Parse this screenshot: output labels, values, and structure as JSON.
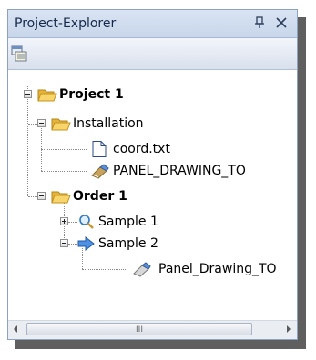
{
  "panel": {
    "title": "Project-Explorer",
    "pin_icon": "pin-icon",
    "close_icon": "close-icon"
  },
  "toolbar": {
    "button_icon": "properties-icon"
  },
  "tree": {
    "nodes": [
      {
        "label": "Project 1",
        "icon": "folder-open-icon",
        "expanded": true
      },
      {
        "label": "Installation",
        "icon": "folder-open-icon",
        "expanded": true
      },
      {
        "label": "coord.txt",
        "icon": "text-file-icon"
      },
      {
        "label": "PANEL_DRAWING_TO",
        "icon": "drawing-icon"
      },
      {
        "label": "Order 1",
        "icon": "folder-open-icon",
        "expanded": true
      },
      {
        "label": "Sample 1",
        "icon": "magnifier-icon",
        "expanded": false
      },
      {
        "label": "Sample 2",
        "icon": "arrow-icon",
        "expanded": true
      },
      {
        "label": "Panel_Drawing_TO",
        "icon": "drawing-icon"
      }
    ]
  },
  "scrollbar": {
    "grip": "III"
  },
  "colors": {
    "titlebar": "#c8d6ea",
    "border": "#8da2c0",
    "folder": "#f2c44e",
    "arrow": "#2f6fd0"
  }
}
